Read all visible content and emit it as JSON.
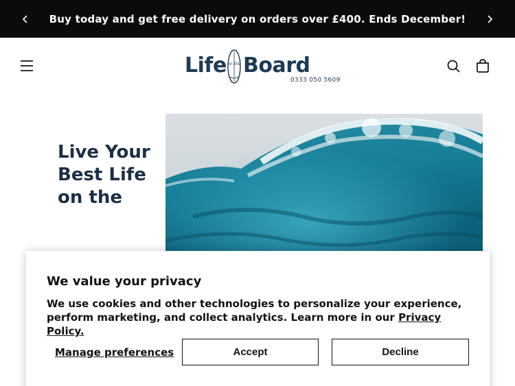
{
  "announcement": {
    "text": "Buy today and get free delivery on orders over £400. Ends December!"
  },
  "header": {
    "logo": {
      "word_left": "Life",
      "word_small": "on the",
      "word_right": "Board",
      "phone": "0333 050 5609"
    },
    "icons": [
      "menu-icon",
      "search-icon",
      "cart-icon"
    ]
  },
  "hero": {
    "heading": "Live Your Best Life on the"
  },
  "cookie_banner": {
    "title": "We value your privacy",
    "body_text": "We use cookies and other technologies to personalize your experience, perform marketing, and collect analytics. Learn more in our ",
    "policy_link": "Privacy Policy.",
    "manage_label": "Manage preferences",
    "accept_label": "Accept",
    "decline_label": "Decline"
  },
  "colors": {
    "announcement_bg": "#0b0b0b",
    "brand_navy": "#1e3a55",
    "text": "#121212"
  }
}
